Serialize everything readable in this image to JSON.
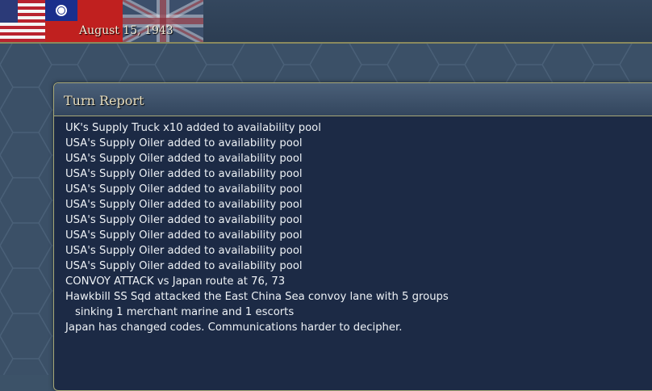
{
  "header": {
    "date": "August 15, 1943",
    "flags": [
      "usa-flag-icon",
      "roc-flag-icon",
      "uk-flag-icon"
    ]
  },
  "turn_report": {
    "title": "Turn Report",
    "lines": [
      {
        "text": "UK's Supply Truck x10 added to availability pool",
        "indent": false
      },
      {
        "text": "USA's Supply Oiler added to availability pool",
        "indent": false
      },
      {
        "text": "USA's Supply Oiler added to availability pool",
        "indent": false
      },
      {
        "text": "USA's Supply Oiler added to availability pool",
        "indent": false
      },
      {
        "text": "USA's Supply Oiler added to availability pool",
        "indent": false
      },
      {
        "text": "USA's Supply Oiler added to availability pool",
        "indent": false
      },
      {
        "text": "USA's Supply Oiler added to availability pool",
        "indent": false
      },
      {
        "text": "USA's Supply Oiler added to availability pool",
        "indent": false
      },
      {
        "text": "USA's Supply Oiler added to availability pool",
        "indent": false
      },
      {
        "text": "USA's Supply Oiler added to availability pool",
        "indent": false
      },
      {
        "text": "CONVOY ATTACK vs Japan route at 76, 73",
        "indent": false
      },
      {
        "text": "Hawkbill SS Sqd attacked the East China Sea convoy lane with 5 groups",
        "indent": false
      },
      {
        "text": "sinking 1 merchant marine and 1 escorts",
        "indent": true
      },
      {
        "text": "Japan has changed codes. Communications harder to decipher.",
        "indent": false
      }
    ]
  }
}
